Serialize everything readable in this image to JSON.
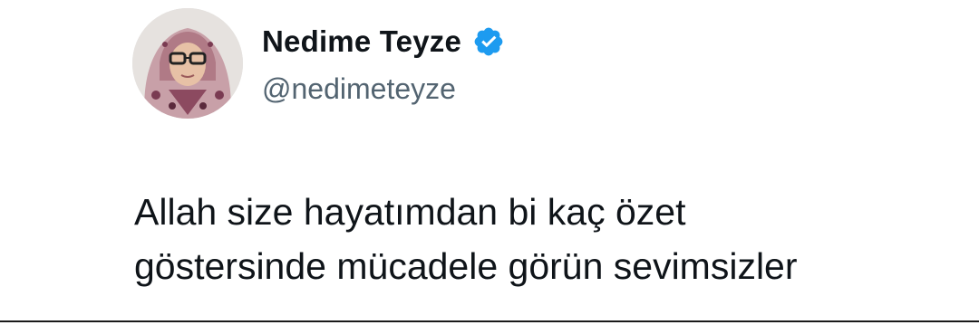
{
  "tweet": {
    "author": {
      "display_name": "Nedime Teyze",
      "handle": "@nedimeteyze",
      "verified": true,
      "avatar_icon": "profile-photo",
      "verified_icon": "verified-badge-icon",
      "verified_color": "#1d9bf0"
    },
    "text_lines": [
      "Allah size hayatımdan bi kaç özet",
      "göstersinde mücadele görün sevimsizler"
    ]
  }
}
